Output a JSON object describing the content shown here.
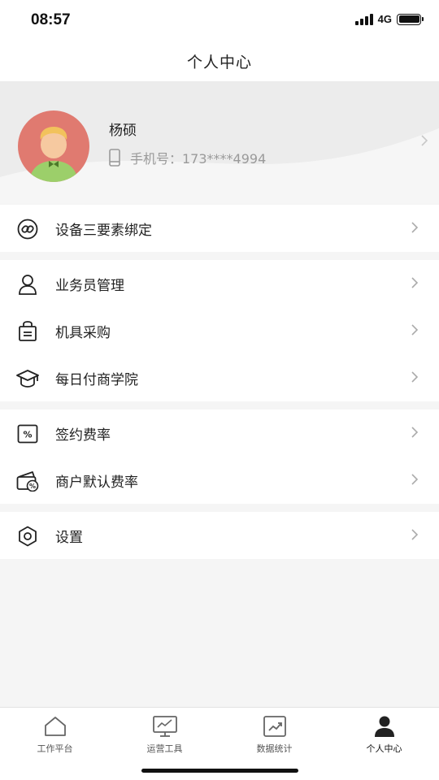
{
  "status_bar": {
    "time": "08:57",
    "network": "4G"
  },
  "header": {
    "title": "个人中心"
  },
  "profile": {
    "name": "杨硕",
    "phone": "手机号：173****4994"
  },
  "groups": [
    {
      "items": [
        {
          "label": "设备三要素绑定",
          "icon": "link-icon"
        }
      ]
    },
    {
      "items": [
        {
          "label": "业务员管理",
          "icon": "user-icon"
        },
        {
          "label": "机具采购",
          "icon": "shopping-bag-icon"
        },
        {
          "label": "每日付商学院",
          "icon": "graduation-cap-icon"
        }
      ]
    },
    {
      "items": [
        {
          "label": "签约费率",
          "icon": "percent-icon"
        },
        {
          "label": "商户默认费率",
          "icon": "wallet-percent-icon"
        }
      ]
    },
    {
      "items": [
        {
          "label": "设置",
          "icon": "settings-hexagon-icon"
        }
      ]
    }
  ],
  "tab_bar": {
    "tabs": [
      {
        "label": "工作平台",
        "icon": "home-icon"
      },
      {
        "label": "运营工具",
        "icon": "monitor-icon"
      },
      {
        "label": "数据统计",
        "icon": "chart-icon"
      },
      {
        "label": "个人中心",
        "icon": "person-icon",
        "active": true
      }
    ]
  },
  "colors": {
    "avatar_bg": "#e07a70",
    "accent": "#111111",
    "muted_text": "#9a9a9a"
  }
}
